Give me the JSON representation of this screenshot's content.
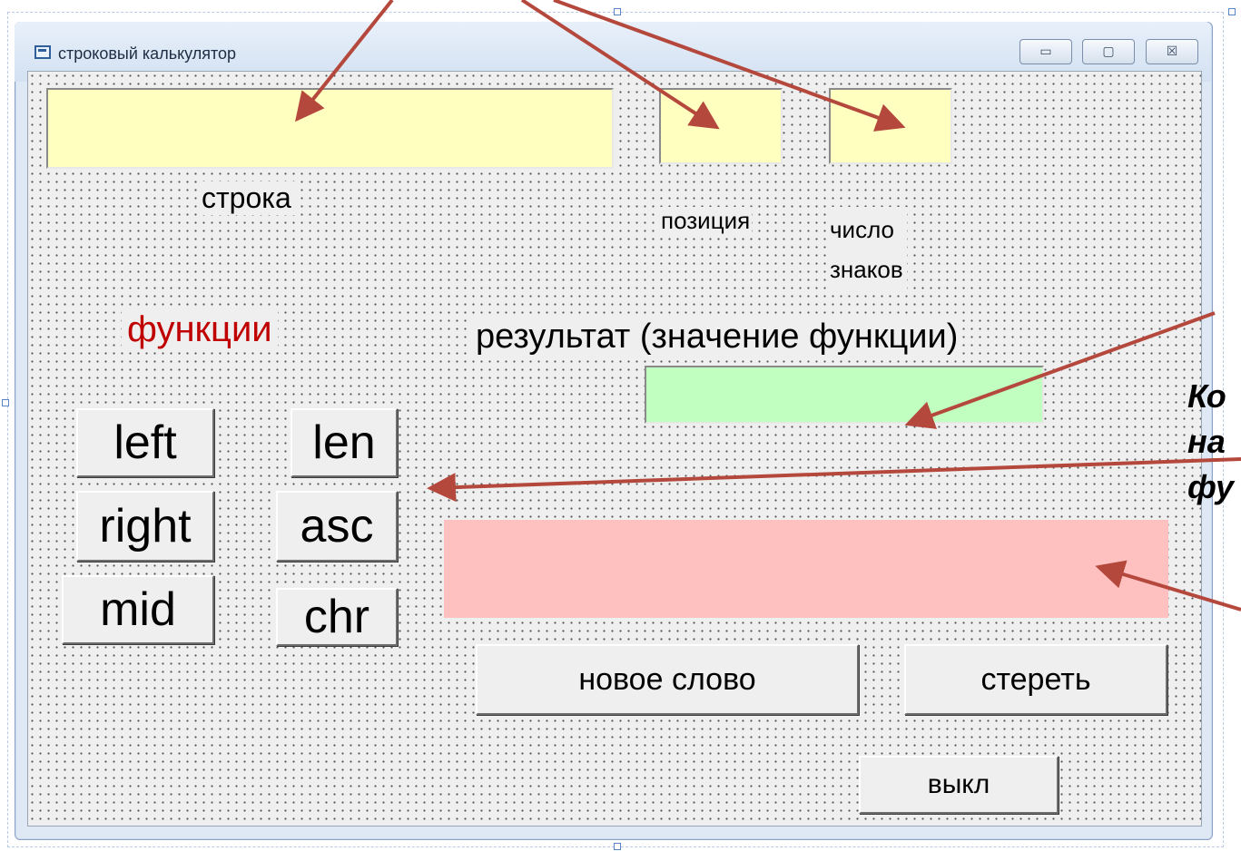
{
  "window": {
    "title": "строковый калькулятор",
    "controls": {
      "minimize": "▭",
      "maximize": "▢",
      "close": "☒"
    }
  },
  "labels": {
    "string": "строка",
    "position": "позиция",
    "count_line1": "число",
    "count_line2": "знаков",
    "functions": "функции",
    "result": "результат (значение функции)"
  },
  "fields": {
    "string": "",
    "position": "",
    "count": "",
    "result": "",
    "error": ""
  },
  "functions": {
    "left": "left",
    "len": "len",
    "right": "right",
    "asc": "asc",
    "mid": "mid",
    "chr": "chr"
  },
  "actions": {
    "new_word": "новое слово",
    "clear": "стереть",
    "off": "выкл"
  },
  "annotation": {
    "line1": "Ко",
    "line2": "на",
    "line3": "фу"
  },
  "colors": {
    "string_field": "#ffffc0",
    "result_field": "#c0ffc0",
    "error_field": "#ffc0c0",
    "functions_label": "#c00000",
    "arrow": "#b5483d"
  }
}
